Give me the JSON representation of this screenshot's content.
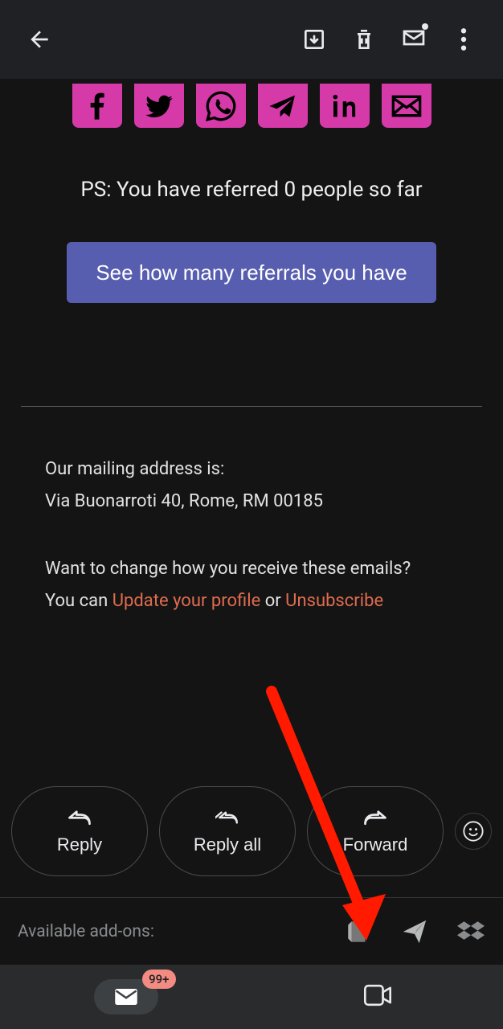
{
  "social": {
    "icons": [
      "facebook",
      "twitter",
      "whatsapp",
      "telegram",
      "linkedin",
      "email"
    ]
  },
  "ps_text": "PS: You have referred 0 people so far",
  "cta_label": "See how many referrals you have",
  "footer": {
    "address_label": "Our mailing address is:",
    "address": "Via Buonarroti 40, Rome, RM 00185",
    "change_q": "Want to change how you receive these emails?",
    "you_can": "You can ",
    "update_profile": "Update your profile",
    "or": " or ",
    "unsubscribe": "Unsubscribe"
  },
  "actions": {
    "reply": "Reply",
    "reply_all": "Reply all",
    "forward": "Forward"
  },
  "addons_label": "Available add-ons:",
  "badge": "99+"
}
